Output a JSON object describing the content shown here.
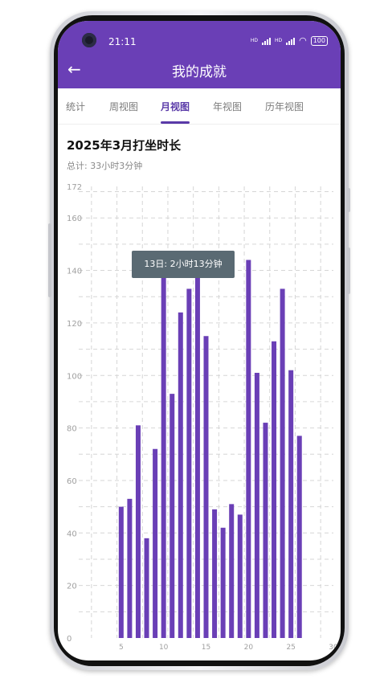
{
  "status_bar": {
    "time": "21:11",
    "battery": "100",
    "net1": "HD",
    "net2": "HD"
  },
  "app_bar": {
    "title": "我的成就",
    "back_icon": "arrow-left-icon"
  },
  "tabs": [
    {
      "label": "统计",
      "active": false
    },
    {
      "label": "周视图",
      "active": false
    },
    {
      "label": "月视图",
      "active": true
    },
    {
      "label": "年视图",
      "active": false
    },
    {
      "label": "历年视图",
      "active": false
    }
  ],
  "header": {
    "title": "2025年3月打坐时长",
    "subtitle": "总计: 33小时3分钟"
  },
  "tooltip": {
    "text": "13日: 2小时13分钟"
  },
  "colors": {
    "accent": "#6a3fb6",
    "bar": "#6a3fb6",
    "tooltip_bg": "#5a6a73"
  },
  "chart_data": {
    "type": "bar",
    "x": [
      5,
      6,
      7,
      8,
      9,
      10,
      11,
      12,
      13,
      14,
      15,
      16,
      17,
      18,
      19,
      20,
      21,
      22,
      23,
      24,
      25,
      26
    ],
    "values": [
      50,
      53,
      81,
      38,
      72,
      140,
      93,
      124,
      133,
      141,
      115,
      49,
      42,
      51,
      47,
      144,
      101,
      82,
      113,
      133,
      102,
      77
    ],
    "xlim": [
      0,
      30
    ],
    "ylim": [
      0,
      172
    ],
    "x_ticks": [
      5,
      10,
      15,
      20,
      25,
      30
    ],
    "y_ticks": [
      0,
      20,
      40,
      60,
      80,
      100,
      120,
      140,
      160,
      172
    ],
    "grid": true
  }
}
